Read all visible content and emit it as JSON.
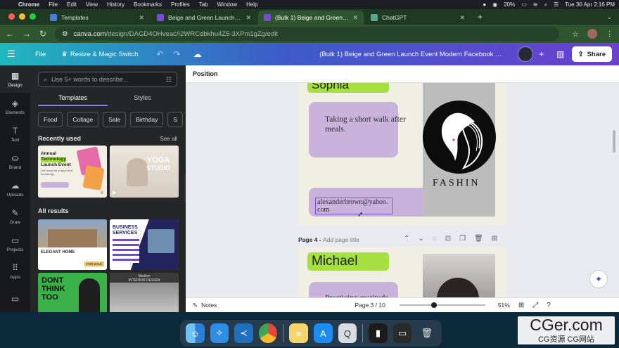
{
  "menubar": {
    "app": "Chrome",
    "items": [
      "File",
      "Edit",
      "View",
      "History",
      "Bookmarks",
      "Profiles",
      "Tab",
      "Window",
      "Help"
    ],
    "battery": "20%",
    "clock": "Tue 30 Apr  2:16 PM"
  },
  "browser": {
    "tabs": [
      {
        "title": "Templates",
        "color": "#4b7be0"
      },
      {
        "title": "Beige and Green Launch Event",
        "color": "#7a4bd8"
      },
      {
        "title": "(Bulk 1) Beige and Green Lau",
        "color": "#7a4bd8"
      },
      {
        "title": "ChatGPT",
        "color": "#5aa890"
      }
    ],
    "url_host": "canva.com",
    "url_path": "/design/DAGD4OHveac/I2WRCdbkhu4Z5-3XPm1gZg/edit"
  },
  "canva": {
    "menu": {
      "file": "File",
      "resize": "Resize & Magic Switch"
    },
    "doc_title": "(Bulk 1) Beige and Green Launch Event Modern Facebook P...",
    "share": "Share",
    "rail": [
      {
        "label": "Design",
        "icon": "design-icon"
      },
      {
        "label": "Elements",
        "icon": "elements-icon"
      },
      {
        "label": "Text",
        "icon": "text-icon"
      },
      {
        "label": "Brand",
        "icon": "brand-icon"
      },
      {
        "label": "Uploads",
        "icon": "uploads-icon"
      },
      {
        "label": "Draw",
        "icon": "draw-icon"
      },
      {
        "label": "Projects",
        "icon": "projects-icon"
      },
      {
        "label": "Apps",
        "icon": "apps-icon"
      }
    ],
    "panel": {
      "search_placeholder": "Use 5+ words to describe...",
      "tabs": [
        "Templates",
        "Styles"
      ],
      "chips": [
        "Food",
        "Collage",
        "Sale",
        "Birthday",
        "S"
      ],
      "recently_used": "Recently used",
      "see_all": "See all",
      "all_results": "All results",
      "thumbs": {
        "t1_lines": [
          "Annual",
          "Technology",
          "Launch Event"
        ],
        "t1_sub": "Get ready for a day full of knowledge.",
        "t2_a": "YOGA",
        "t2_b": "STUDIO",
        "t3_caption": "ELEGANT HOME",
        "t3_sale": "FOR SALE",
        "t4_a": "BUSINESS",
        "t4_b": "SERVICES",
        "t5_lines": [
          "DONT",
          "THINK",
          "TOO"
        ],
        "t6_a": "Modern",
        "t6_b": "INTERIOR DESIGN"
      }
    },
    "toolbar_label": "Position",
    "page3": {
      "name": "Sophia",
      "bubble1": "Taking a short walk after meals.",
      "bubble2_line1": "alexanderbrown@yahoo.",
      "bubble2_line2": "com",
      "brand": "FASHIN"
    },
    "page4": {
      "label": "Page 4",
      "add_title": "Add page title",
      "name": "Michael",
      "bubble1": "Practicing gratitude"
    },
    "footer": {
      "notes": "Notes",
      "page_count": "Page 3 / 10",
      "zoom": "51%",
      "zoom_fraction": 0.4
    }
  },
  "watermark": {
    "main": "CGer.com",
    "sub": "CG资源 CG网站"
  },
  "colors": {
    "accent_green": "#a6df40",
    "bubble_purple": "#c9b3dc",
    "page_bg": "#f1efe4",
    "canva_gradient_start": "#1fb8bd",
    "canva_gradient_end": "#6b3fd0"
  }
}
